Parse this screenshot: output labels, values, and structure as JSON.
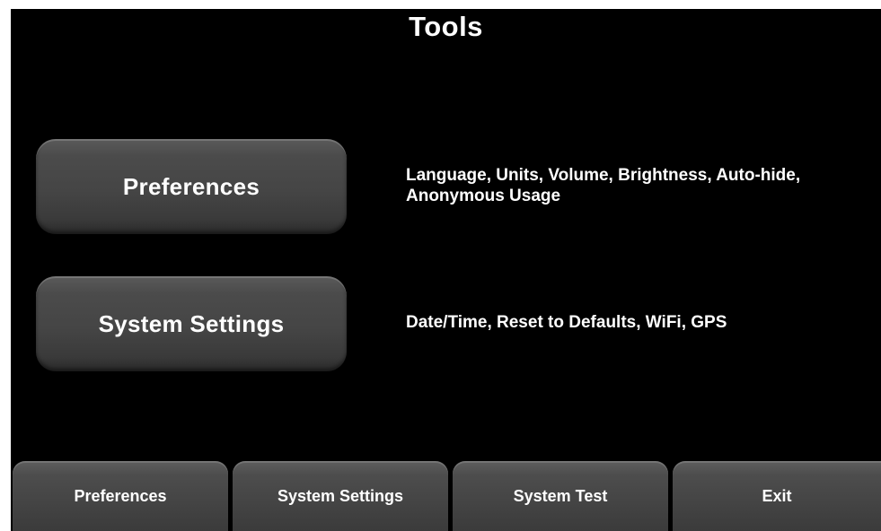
{
  "header": {
    "title": "Tools"
  },
  "main": {
    "preferences_button": "Preferences",
    "preferences_description": "Language, Units, Volume, Brightness, Auto-hide, Anonymous Usage",
    "system_settings_button": "System Settings",
    "system_settings_description": "Date/Time, Reset to Defaults, WiFi, GPS"
  },
  "bottom_bar": {
    "tabs": [
      {
        "label": "Preferences"
      },
      {
        "label": "System Settings"
      },
      {
        "label": "System Test"
      },
      {
        "label": "Exit"
      }
    ]
  },
  "colors": {
    "background": "#000000",
    "button": "#464646",
    "text": "#ffffff"
  }
}
